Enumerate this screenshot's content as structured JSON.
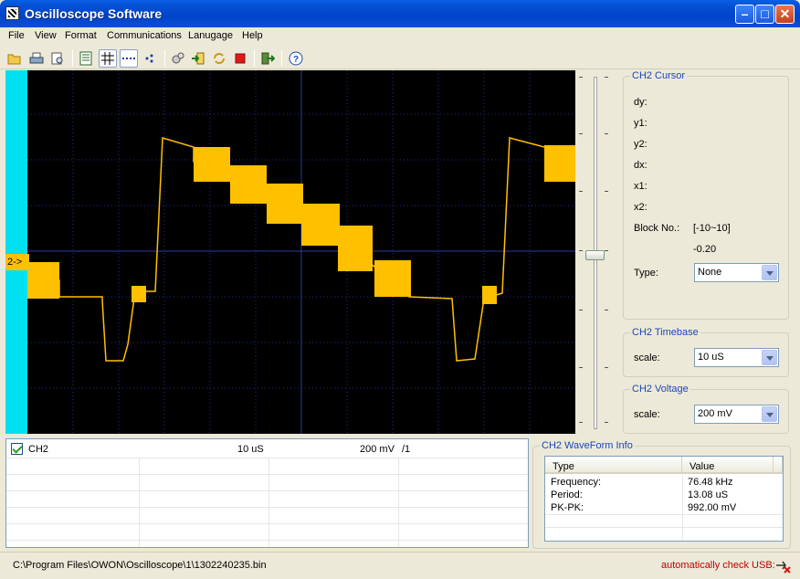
{
  "window": {
    "title": "Oscilloscope Software"
  },
  "menu": [
    "File",
    "View",
    "Format",
    "Communications",
    "Lanugage",
    "Help"
  ],
  "toolbar": {
    "icons": [
      "open-icon",
      "print-icon",
      "print-preview-icon",
      "list-icon",
      "grid-icon",
      "dotted-line-icon",
      "dots-icon",
      "connect-icon",
      "import-icon",
      "refresh-icon",
      "stop-icon",
      "export-icon",
      "help-icon"
    ]
  },
  "scope": {
    "channel_marker": "2->",
    "trace_color": "#ffc000",
    "background": "#000000"
  },
  "cursor_panel": {
    "title": "CH2 Cursor",
    "dy_label": "dy:",
    "y1_label": "y1:",
    "y2_label": "y2:",
    "dx_label": "dx:",
    "x1_label": "x1:",
    "x2_label": "x2:",
    "block_label": "Block No.:",
    "block_range": "[-10~10]",
    "block_value": "-0.20",
    "type_label": "Type:",
    "type_value": "None"
  },
  "timebase_panel": {
    "title": "CH2 Timebase",
    "scale_label": "scale:",
    "scale_value": "10 uS"
  },
  "voltage_panel": {
    "title": "CH2 Voltage",
    "scale_label": "scale:",
    "scale_value": "200 mV"
  },
  "channel_list": {
    "channel": "CH2",
    "checked": true,
    "timebase": "10 uS",
    "voltage": "200 mV",
    "probe": "/1"
  },
  "waveform_info": {
    "title": "CH2 WaveForm Info",
    "col_type": "Type",
    "col_value": "Value",
    "rows": [
      {
        "type": "Frequency:",
        "value": "76.48 kHz"
      },
      {
        "type": "Period:",
        "value": "13.08 uS"
      },
      {
        "type": "PK-PK:",
        "value": "992.00 mV"
      }
    ]
  },
  "status": {
    "path": "C:\\Program Files\\OWON\\Oscilloscope\\1\\1302240235.bin",
    "usb_text": "automatically check USB:"
  }
}
